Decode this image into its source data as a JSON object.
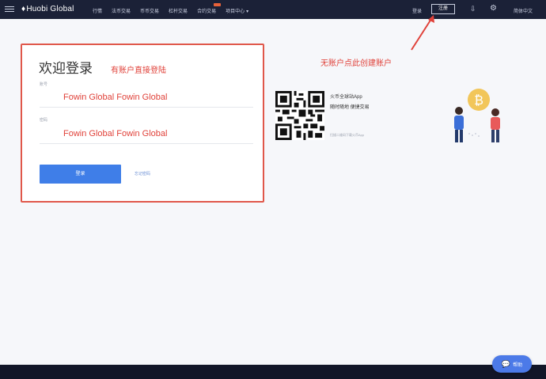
{
  "nav": {
    "brand": "Huobi Global",
    "items": [
      "行情",
      "法币交易",
      "币币交易",
      "杠杆交易",
      "合约交易",
      "项目中心"
    ],
    "project_caret": "▾",
    "login": "登录",
    "register": "注册",
    "language": "简体中文"
  },
  "login": {
    "title": "欢迎登录",
    "annotation": "有账户直接登陆",
    "account_label": "账号",
    "account_value": "Fowin Global Fowin Global",
    "password_label": "密码",
    "password_value": "Fowin Global Fowin Global",
    "submit": "登录",
    "forgot": "忘记密码"
  },
  "annotation_create": "无账户点此创建账户",
  "app": {
    "title": "火币全球站App",
    "subtitle": "随时随地 便捷交易",
    "hint": "扫描二维码下载火币App"
  },
  "help": {
    "label": "帮助"
  },
  "colors": {
    "nav_bg": "#1b2137",
    "accent": "#3f7ee8",
    "annotation": "#e0423a"
  }
}
